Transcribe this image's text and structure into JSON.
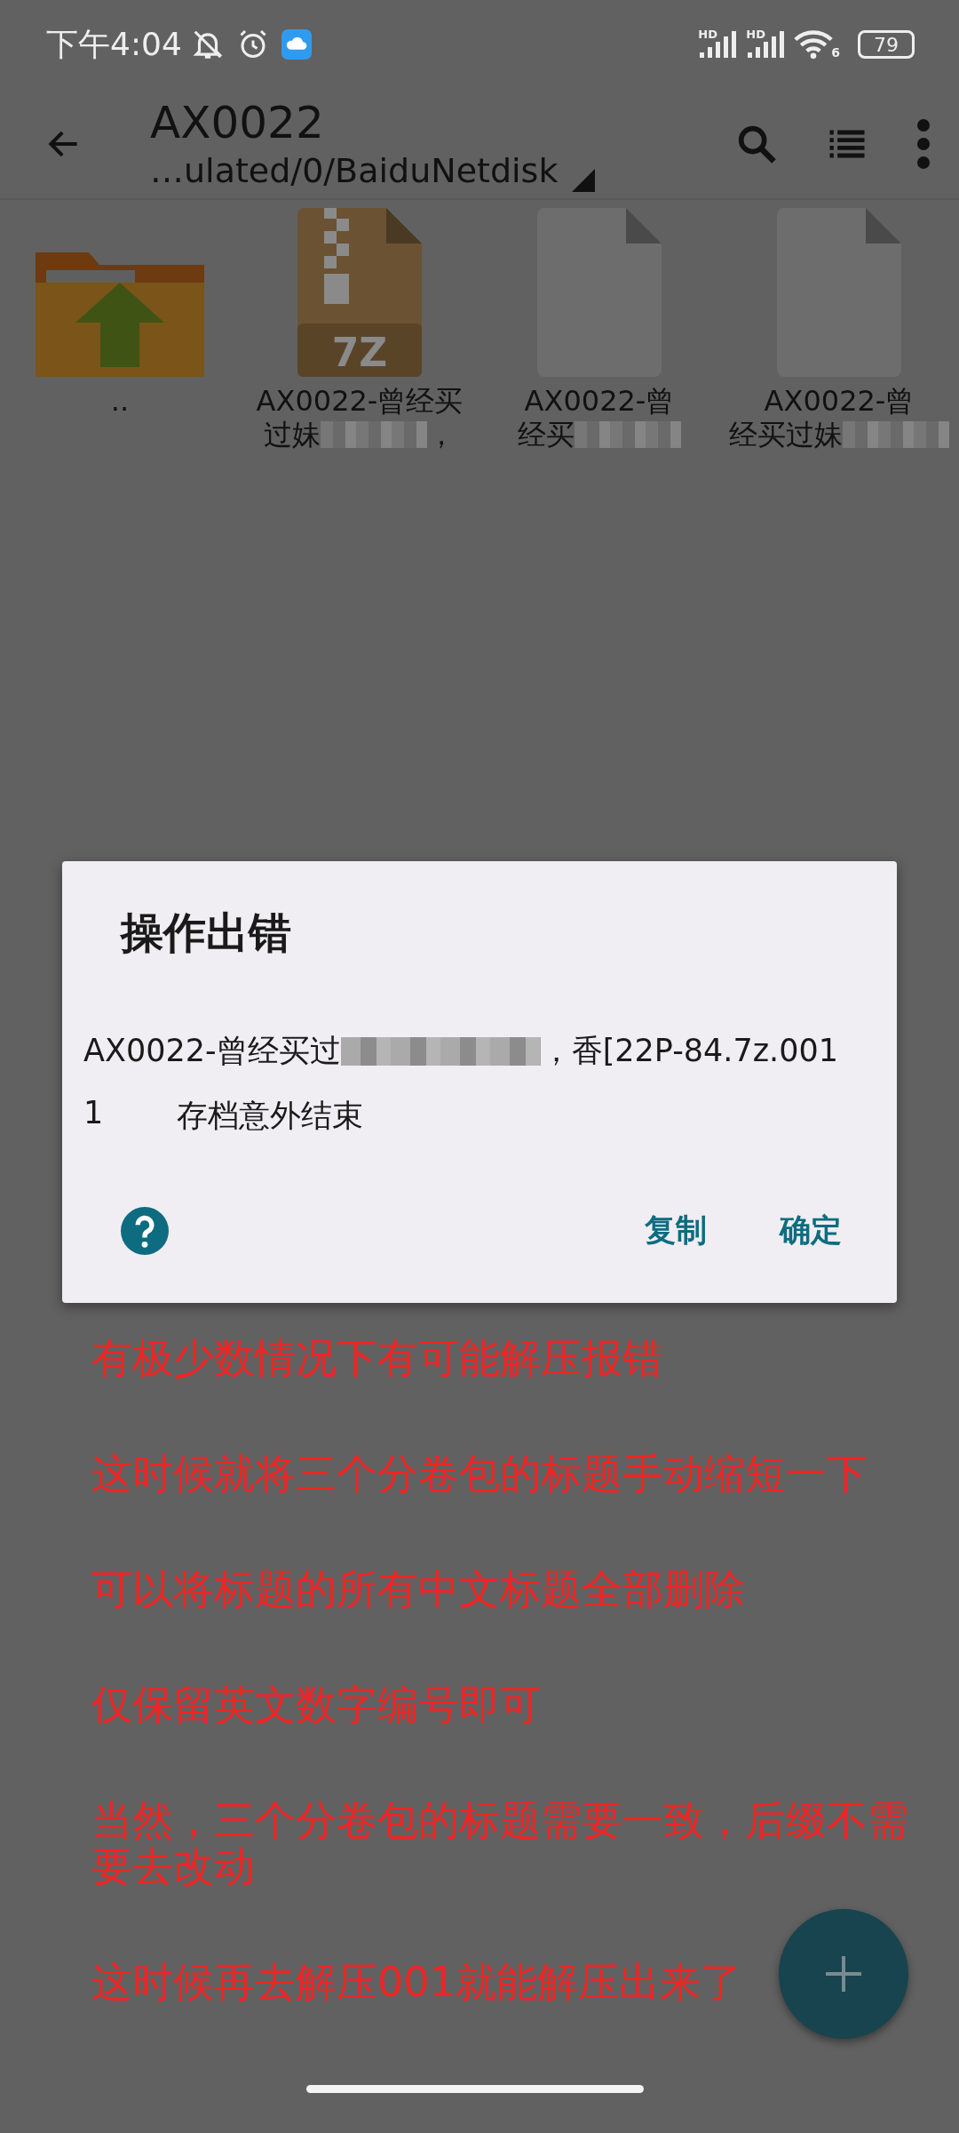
{
  "status_bar": {
    "time": "下午4:04",
    "signal_labels": [
      "HD",
      "HD"
    ],
    "wifi_label": "6",
    "battery": "79"
  },
  "toolbar": {
    "title": "AX0022",
    "path": "…ulated/0/BaiduNetdisk"
  },
  "files": [
    {
      "kind": "parent",
      "lines": [
        {
          "text": ".."
        }
      ]
    },
    {
      "kind": "archive",
      "badge": "7Z",
      "lines": [
        {
          "text": "AX0022-曾经买"
        },
        {
          "text": "过妹",
          "blurred": true,
          "tail": "，"
        }
      ]
    },
    {
      "kind": "file",
      "lines": [
        {
          "text": "AX0022-曾"
        },
        {
          "text": "经买",
          "blurred": true
        }
      ]
    },
    {
      "kind": "file",
      "lines": [
        {
          "text": "AX0022-曾"
        },
        {
          "text": "经买过妹",
          "blurred": true
        }
      ]
    }
  ],
  "dialog": {
    "title": "操作出错",
    "message": {
      "text": "AX0022-曾经买过",
      "blurred": true,
      "tail": "，香[22P-84.7z.001"
    },
    "detail": {
      "code": "1",
      "text": "存档意外结束"
    },
    "buttons": [
      "复制",
      "确定"
    ]
  },
  "notes": [
    "有极少数情况下有可能解压报错",
    "这时候就将三个分卷包的标题手动缩短一下",
    "可以将标题的所有中文标题全部删除",
    "仅保留英文数字编号即可",
    "当然，三个分卷包的标题需要一致，后缀不需要去改动",
    "这时候再去解压001就能解压出来了"
  ]
}
